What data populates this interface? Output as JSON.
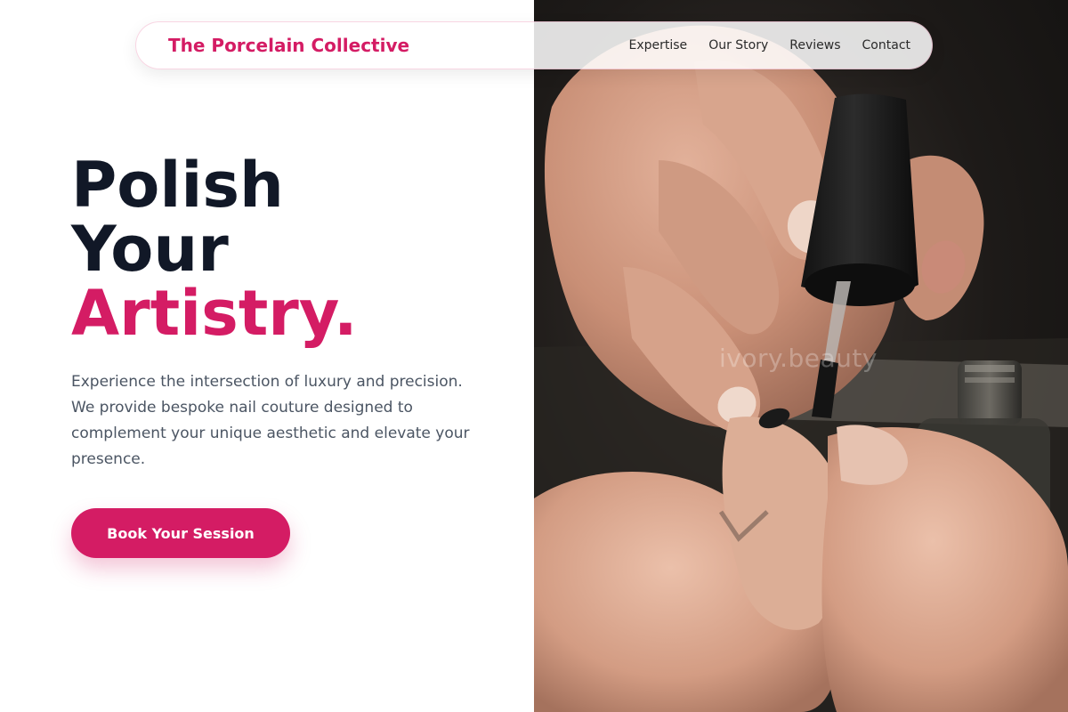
{
  "nav": {
    "brand": "The Porcelain Collective",
    "links": [
      "Expertise",
      "Our Story",
      "Reviews",
      "Contact"
    ]
  },
  "hero": {
    "title_line1": "Polish",
    "title_line2": "Your",
    "title_accent": "Artistry.",
    "description": "Experience the intersection of luxury and precision. We provide bespoke nail couture designed to complement your unique aesthetic and elevate your presence.",
    "cta_label": "Book Your Session"
  },
  "photo": {
    "watermark": "ivory.beauty",
    "subject": "hands applying nail polish"
  },
  "colors": {
    "accent": "#d41c64",
    "heading": "#111827",
    "body_text": "#4b5563"
  }
}
